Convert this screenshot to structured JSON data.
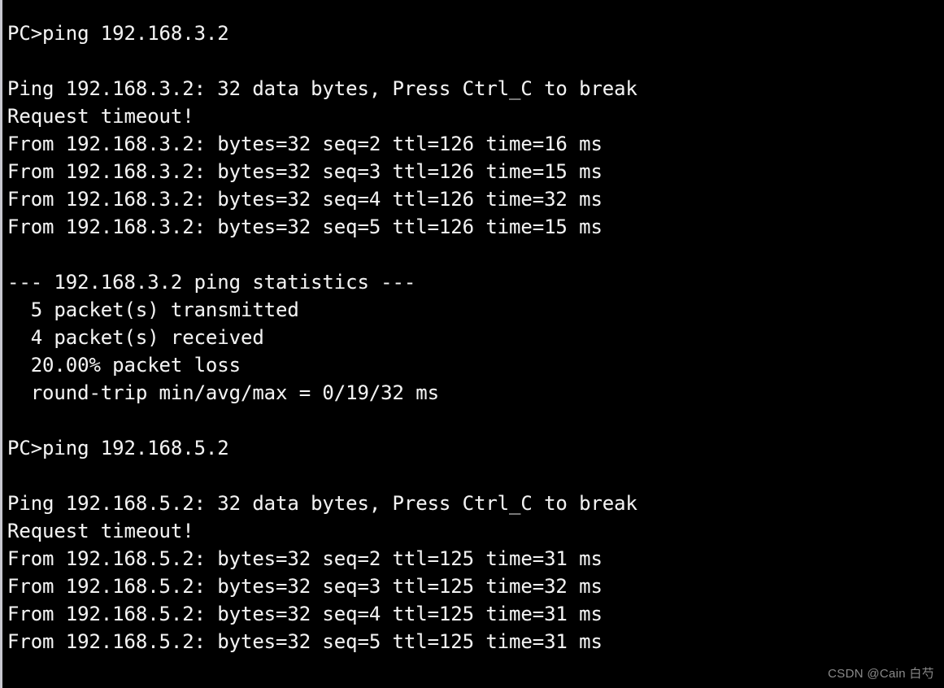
{
  "window": {
    "kind": "console-terminal",
    "background_color": "#000000",
    "text_color": "#f2f2f2",
    "border_color": "#c8c8d0"
  },
  "terminal": {
    "prompt": "PC>",
    "lines": [
      "PC>ping 192.168.3.2",
      "",
      "Ping 192.168.3.2: 32 data bytes, Press Ctrl_C to break",
      "Request timeout!",
      "From 192.168.3.2: bytes=32 seq=2 ttl=126 time=16 ms",
      "From 192.168.3.2: bytes=32 seq=3 ttl=126 time=15 ms",
      "From 192.168.3.2: bytes=32 seq=4 ttl=126 time=32 ms",
      "From 192.168.3.2: bytes=32 seq=5 ttl=126 time=15 ms",
      "",
      "--- 192.168.3.2 ping statistics ---",
      "  5 packet(s) transmitted",
      "  4 packet(s) received",
      "  20.00% packet loss",
      "  round-trip min/avg/max = 0/19/32 ms",
      "",
      "PC>ping 192.168.5.2",
      "",
      "Ping 192.168.5.2: 32 data bytes, Press Ctrl_C to break",
      "Request timeout!",
      "From 192.168.5.2: bytes=32 seq=2 ttl=125 time=31 ms",
      "From 192.168.5.2: bytes=32 seq=3 ttl=125 time=32 ms",
      "From 192.168.5.2: bytes=32 seq=4 ttl=125 time=31 ms",
      "From 192.168.5.2: bytes=32 seq=5 ttl=125 time=31 ms"
    ]
  },
  "sessions": [
    {
      "command": "ping 192.168.3.2",
      "target": "192.168.3.2",
      "data_bytes": 32,
      "break_hint": "Press Ctrl_C to break",
      "replies": [
        {
          "seq": 1,
          "status": "Request timeout!"
        },
        {
          "seq": 2,
          "bytes": 32,
          "ttl": 126,
          "time_ms": 16
        },
        {
          "seq": 3,
          "bytes": 32,
          "ttl": 126,
          "time_ms": 15
        },
        {
          "seq": 4,
          "bytes": 32,
          "ttl": 126,
          "time_ms": 32
        },
        {
          "seq": 5,
          "bytes": 32,
          "ttl": 126,
          "time_ms": 15
        }
      ],
      "statistics": {
        "header": "--- 192.168.3.2 ping statistics ---",
        "transmitted": "5 packet(s) transmitted",
        "received": "4 packet(s) received",
        "loss": "20.00% packet loss",
        "round_trip": "round-trip min/avg/max = 0/19/32 ms"
      }
    },
    {
      "command": "ping 192.168.5.2",
      "target": "192.168.5.2",
      "data_bytes": 32,
      "break_hint": "Press Ctrl_C to break",
      "replies": [
        {
          "seq": 1,
          "status": "Request timeout!"
        },
        {
          "seq": 2,
          "bytes": 32,
          "ttl": 125,
          "time_ms": 31
        },
        {
          "seq": 3,
          "bytes": 32,
          "ttl": 125,
          "time_ms": 32
        },
        {
          "seq": 4,
          "bytes": 32,
          "ttl": 125,
          "time_ms": 31
        },
        {
          "seq": 5,
          "bytes": 32,
          "ttl": 125,
          "time_ms": 31
        }
      ],
      "statistics": null
    }
  ],
  "watermark": {
    "text": "CSDN @Cain 白芍",
    "color": "#8a8a8a"
  }
}
